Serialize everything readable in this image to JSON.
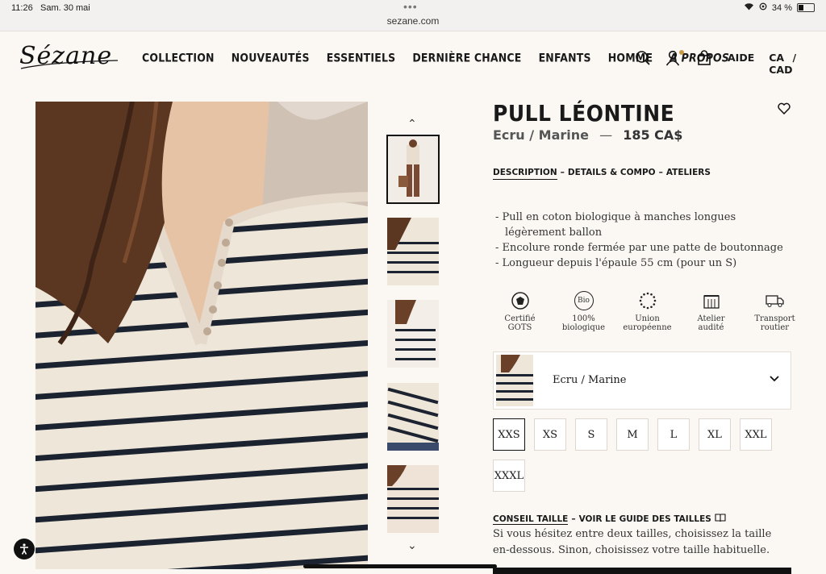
{
  "status_bar": {
    "time": "11:26",
    "date": "Sam. 30 mai",
    "url": "sezane.com",
    "battery": "34 %",
    "battery_level": 0.34
  },
  "header": {
    "logo": "Sézane",
    "menu": [
      {
        "label": "COLLECTION"
      },
      {
        "label": "NOUVEAUTÉS"
      },
      {
        "label": "ESSENTIELS"
      },
      {
        "label": "DERNIÈRE CHANCE"
      },
      {
        "label": "ENFANTS"
      },
      {
        "label": "HOMME"
      },
      {
        "label": "À PROPOS"
      }
    ],
    "icons": [
      "search-icon",
      "account-icon",
      "bag-icon"
    ],
    "help": "AIDE",
    "region": "CA",
    "separator": "/",
    "currency": "CAD"
  },
  "product": {
    "title": "PULL LÉONTINE",
    "color": "Ecru / Marine",
    "dash": "—",
    "price": "185 CA$",
    "tabs": {
      "description": "DESCRIPTION",
      "sep1": "–",
      "details": "DETAILS & COMPO",
      "sep2": "–",
      "ateliers": "ATELIERS"
    },
    "description": [
      "- Pull en coton biologique à manches longues légèrement ballon",
      "- Encolure ronde fermée par une patte de boutonnage",
      "- Longueur depuis l'épaule 55 cm (pour un S)"
    ],
    "certifications": [
      {
        "line1": "Certifié",
        "line2": "GOTS",
        "icon": "gots-icon"
      },
      {
        "line1": "100%",
        "line2": "biologique",
        "icon": "bio-icon",
        "badge": "Bio"
      },
      {
        "line1": "Union",
        "line2": "européenne",
        "icon": "eu-icon"
      },
      {
        "line1": "Atelier",
        "line2": "audité",
        "icon": "factory-icon"
      },
      {
        "line1": "Transport",
        "line2": "routier",
        "icon": "truck-icon"
      }
    ],
    "color_select": {
      "value": "Ecru / Marine"
    },
    "sizes": [
      "XXS",
      "XS",
      "S",
      "M",
      "L",
      "XL",
      "XXL",
      "XXXL"
    ],
    "selected_size": "XXS",
    "size_advice": {
      "label": "CONSEIL TAILLE",
      "sep": "–",
      "guide": "VOIR LE GUIDE DES TAILLES",
      "text": "Si vous hésitez entre deux tailles, choisissez la taille en-dessous. Sinon, choisissez votre taille habituelle."
    }
  },
  "colors": {
    "background": "#fbf8f4",
    "text": "#1a1a1a",
    "accent_dot": "#c89a46",
    "knit": "#efe6da",
    "stripe": "#1c2330"
  }
}
